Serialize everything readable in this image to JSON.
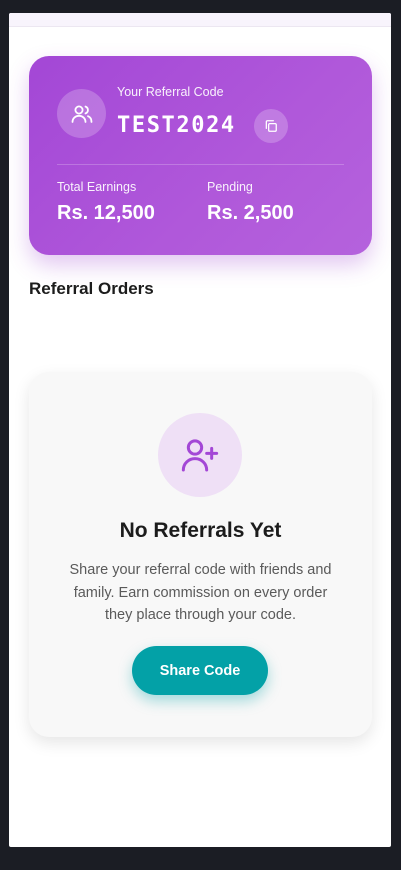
{
  "referral_card": {
    "code_label": "Your Referral Code",
    "code": "TEST2024",
    "avatar_icon": "users-icon",
    "copy_icon": "copy-icon",
    "total_earnings_label": "Total Earnings",
    "total_earnings_value": "Rs. 12,500",
    "pending_label": "Pending",
    "pending_value": "Rs. 2,500",
    "gradient_start": "#a347d6",
    "gradient_end": "#b562dd"
  },
  "section": {
    "title": "Referral Orders"
  },
  "empty_state": {
    "icon": "user-plus-icon",
    "title": "No Referrals Yet",
    "description": "Share your referral code with friends and family. Earn commission on every order they place through your code.",
    "button_label": "Share Code",
    "button_color": "#03a1a7"
  }
}
